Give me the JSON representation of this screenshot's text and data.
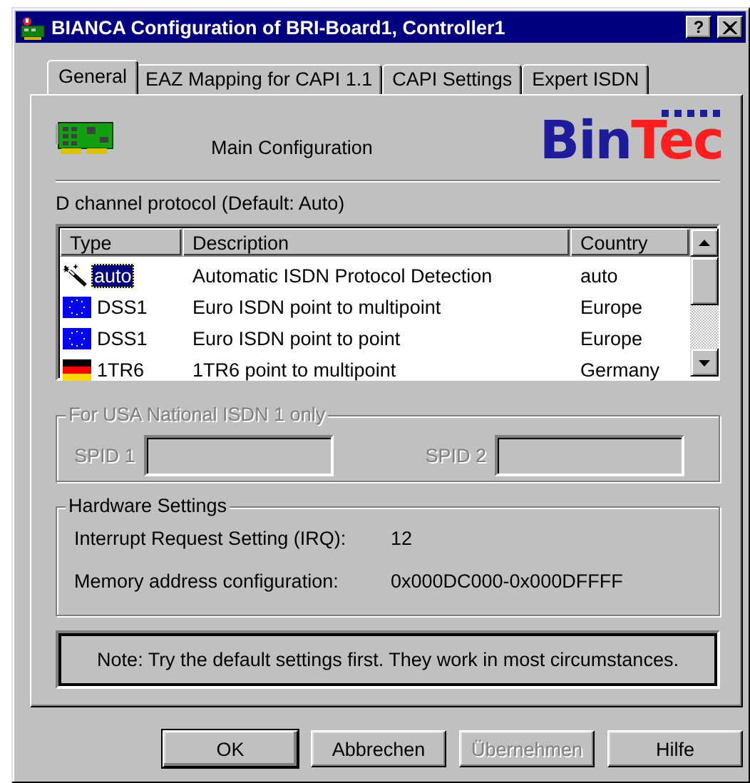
{
  "window": {
    "title": "BIANCA Configuration of BRI-Board1, Controller1",
    "help_button": "?"
  },
  "tabs": [
    {
      "label": "General",
      "selected": true
    },
    {
      "label": "EAZ Mapping for CAPI 1.1",
      "selected": false
    },
    {
      "label": "CAPI Settings",
      "selected": false
    },
    {
      "label": "Expert ISDN",
      "selected": false
    }
  ],
  "header": {
    "title": "Main Configuration",
    "logo": [
      {
        "text": "Bin",
        "color": "#1c1c9c"
      },
      {
        "text": "Tec",
        "color": "#ff1e1e"
      }
    ]
  },
  "protocol": {
    "label": "D channel protocol (Default: Auto)",
    "columns": [
      "Type",
      "Description",
      "Country"
    ],
    "rows": [
      {
        "kind": "wand",
        "type": "auto",
        "description": "Automatic ISDN Protocol Detection",
        "country": "auto",
        "selected": true
      },
      {
        "kind": "eu",
        "type": "DSS1",
        "description": "Euro ISDN point to multipoint",
        "country": "Europe",
        "selected": false
      },
      {
        "kind": "eu",
        "type": "DSS1",
        "description": "Euro ISDN point to point",
        "country": "Europe",
        "selected": false
      },
      {
        "kind": "de",
        "type": "1TR6",
        "description": "1TR6 point to multipoint",
        "country": "Germany",
        "selected": false
      }
    ]
  },
  "usa_group": {
    "title": "For USA National ISDN 1 only",
    "disabled": true,
    "fields": [
      {
        "label": "SPID 1"
      },
      {
        "label": "SPID 2"
      }
    ]
  },
  "hardware": {
    "title": "Hardware Settings",
    "rows": [
      {
        "label": "Interrupt Request Setting (IRQ):",
        "value": "12"
      },
      {
        "label": "Memory address configuration:",
        "value": "0x000DC000-0x000DFFFF"
      }
    ]
  },
  "note": "Note: Try the default settings first. They work in most circumstances.",
  "buttons": [
    {
      "label": "OK",
      "default": true,
      "disabled": false
    },
    {
      "label": "Abbrechen",
      "default": false,
      "disabled": false
    },
    {
      "label": "Übernehmen",
      "default": false,
      "disabled": true
    },
    {
      "label": "Hilfe",
      "default": false,
      "disabled": false
    }
  ]
}
